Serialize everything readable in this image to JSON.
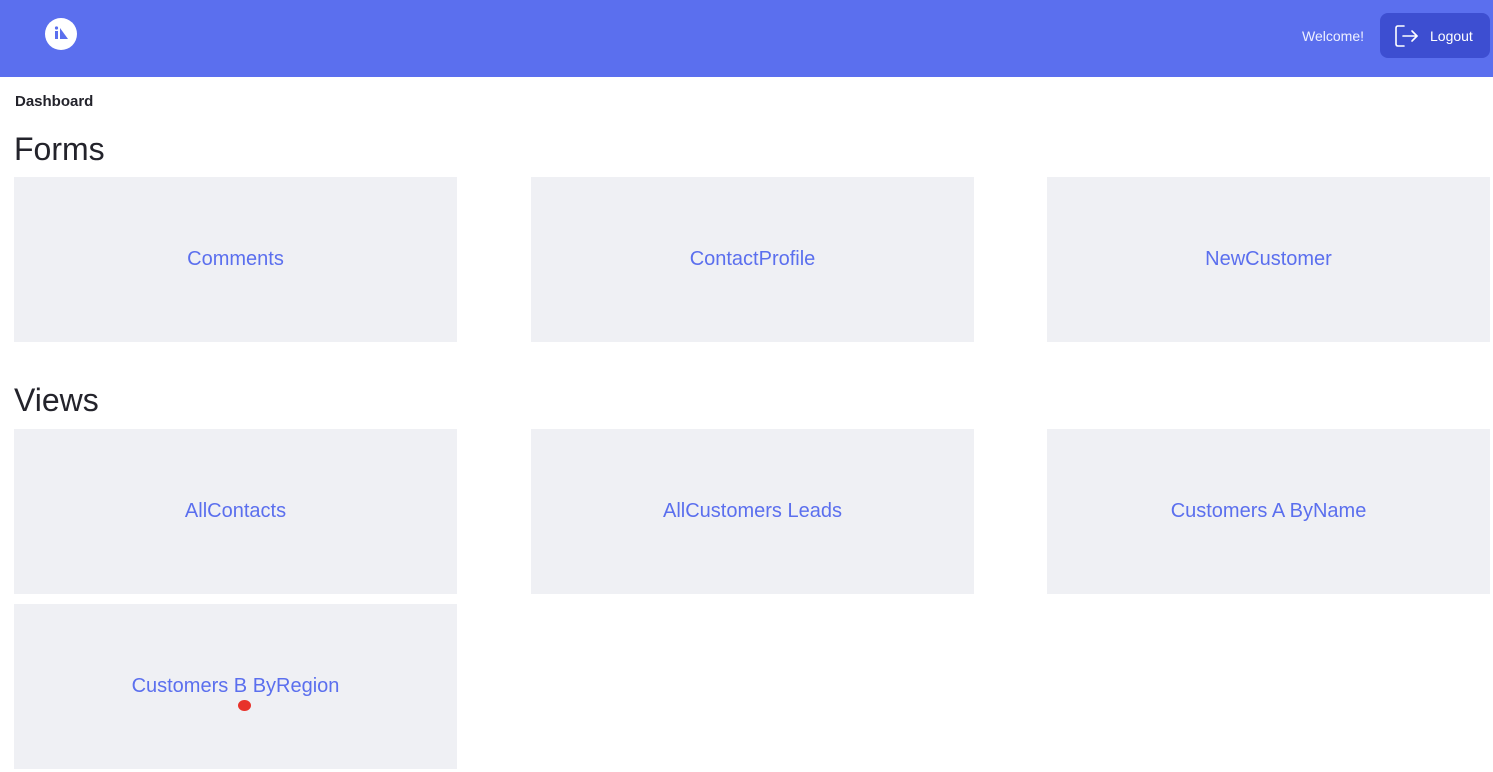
{
  "header": {
    "welcome_text": "Welcome!",
    "logout_label": "Logout",
    "logo_icon": "brand-logo-icon",
    "logout_icon": "logout-icon",
    "bg_color": "#5b6fee",
    "button_color": "#3d4ed1"
  },
  "breadcrumb": "Dashboard",
  "forms": {
    "title": "Forms",
    "cards": [
      "Comments",
      "ContactProfile",
      "NewCustomer"
    ]
  },
  "views": {
    "title": "Views",
    "cards": [
      "AllContacts",
      "AllCustomers Leads",
      "Customers A ByName",
      "Customers B ByRegion"
    ]
  },
  "colors": {
    "card_bg": "#eff0f4",
    "card_text": "#5b6fee"
  }
}
